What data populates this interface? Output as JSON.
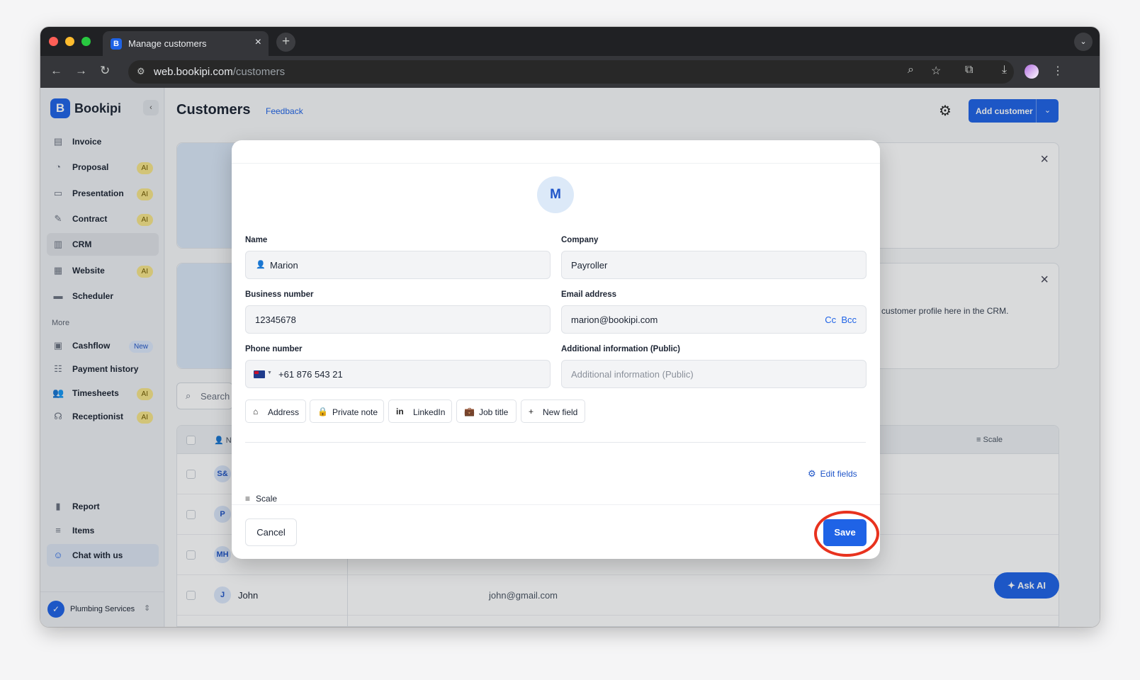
{
  "browser": {
    "tab_title": "Manage customers",
    "url_host": "web.bookipi.com",
    "url_path": "/customers"
  },
  "sidebar": {
    "brand": "Bookipi",
    "items": [
      {
        "label": "Invoice",
        "icon": "invoice-icon",
        "badge": ""
      },
      {
        "label": "Proposal",
        "icon": "proposal-icon",
        "badge": "AI"
      },
      {
        "label": "Presentation",
        "icon": "presentation-icon",
        "badge": "AI"
      },
      {
        "label": "Contract",
        "icon": "contract-icon",
        "badge": "AI"
      },
      {
        "label": "CRM",
        "icon": "crm-icon",
        "badge": "",
        "active": true
      },
      {
        "label": "Website",
        "icon": "website-icon",
        "badge": "AI"
      },
      {
        "label": "Scheduler",
        "icon": "scheduler-icon",
        "badge": ""
      }
    ],
    "more_label": "More",
    "more_items": [
      {
        "label": "Cashflow",
        "icon": "cashflow-icon",
        "badge": "New"
      },
      {
        "label": "Payment history",
        "icon": "payment-history-icon",
        "badge": ""
      },
      {
        "label": "Timesheets",
        "icon": "timesheets-icon",
        "badge": "AI"
      },
      {
        "label": "Receptionist",
        "icon": "receptionist-icon",
        "badge": "AI"
      }
    ],
    "bottom_items": [
      {
        "label": "Report",
        "icon": "report-icon"
      },
      {
        "label": "Items",
        "icon": "items-icon"
      },
      {
        "label": "Chat with us",
        "icon": "chat-icon"
      }
    ],
    "business_name": "Plumbing Services"
  },
  "header": {
    "title": "Customers",
    "feedback": "Feedback",
    "add_customer": "Add customer"
  },
  "background": {
    "card_text": "customer profile here in the CRM.",
    "search_placeholder": "Search",
    "table_header_scale": "Scale",
    "table_header_name": "N",
    "rows": [
      {
        "initials": "S&",
        "name": "",
        "email": ""
      },
      {
        "initials": "P",
        "name": "",
        "email": ""
      },
      {
        "initials": "MH",
        "name": "",
        "email": ""
      },
      {
        "initials": "J",
        "name": "John",
        "email": "john@gmail.com"
      }
    ],
    "ask_ai": "Ask AI"
  },
  "modal": {
    "avatar_initial": "M",
    "name_label": "Name",
    "name_value": "Marion",
    "company_label": "Company",
    "company_value": "Payroller",
    "business_number_label": "Business number",
    "business_number_value": "12345678",
    "email_label": "Email address",
    "email_value": "marion@bookipi.com",
    "cc_label": "Cc",
    "bcc_label": "Bcc",
    "phone_label": "Phone number",
    "phone_value": "+61 876 543 21",
    "additional_label": "Additional information (Public)",
    "additional_placeholder": "Additional information (Public)",
    "chips": [
      "Address",
      "Private note",
      "LinkedIn",
      "Job title",
      "New field"
    ],
    "edit_fields": "Edit fields",
    "scale_label": "Scale",
    "cancel": "Cancel",
    "save": "Save"
  },
  "colors": {
    "accent": "#1f63e6",
    "highlight_ring": "#e8321e"
  }
}
